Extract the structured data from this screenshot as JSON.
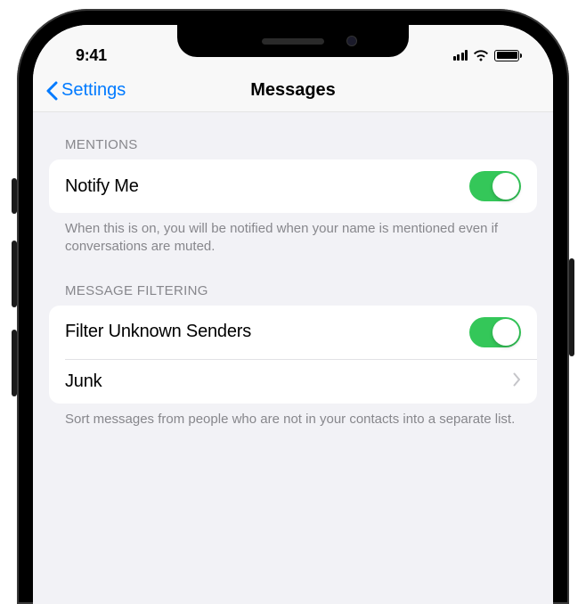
{
  "status": {
    "time": "9:41"
  },
  "nav": {
    "back_label": "Settings",
    "title": "Messages"
  },
  "sections": {
    "mentions": {
      "header": "Mentions",
      "notify_me": {
        "label": "Notify Me",
        "value": true
      },
      "footer": "When this is on, you will be notified when your name is mentioned even if conversations are muted."
    },
    "filtering": {
      "header": "Message Filtering",
      "filter_unknown": {
        "label": "Filter Unknown Senders",
        "value": true
      },
      "junk": {
        "label": "Junk"
      },
      "footer": "Sort messages from people who are not in your contacts into a separate list."
    }
  }
}
